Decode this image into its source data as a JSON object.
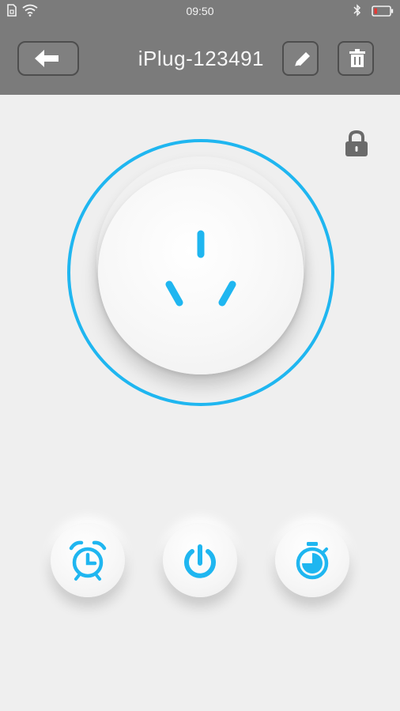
{
  "status_bar": {
    "time": "09:50",
    "left_icons": [
      "sim-card-icon",
      "wifi-icon"
    ],
    "right_icons": [
      "bluetooth-icon",
      "battery-low-icon"
    ],
    "battery_color": "#e53935"
  },
  "header": {
    "title": "iPlug-123491",
    "back_icon": "back-arrow-icon",
    "edit_icon": "pencil-icon",
    "delete_icon": "trash-icon",
    "background_color": "#7b7b7b"
  },
  "device": {
    "lock_icon": "lock-icon",
    "socket_icon": "power-socket-icon",
    "accent_color": "#1fb6f0"
  },
  "actions": [
    {
      "name": "alarm-timer",
      "icon": "alarm-clock-icon"
    },
    {
      "name": "power-toggle",
      "icon": "power-icon"
    },
    {
      "name": "countdown-timer",
      "icon": "stopwatch-icon"
    }
  ]
}
